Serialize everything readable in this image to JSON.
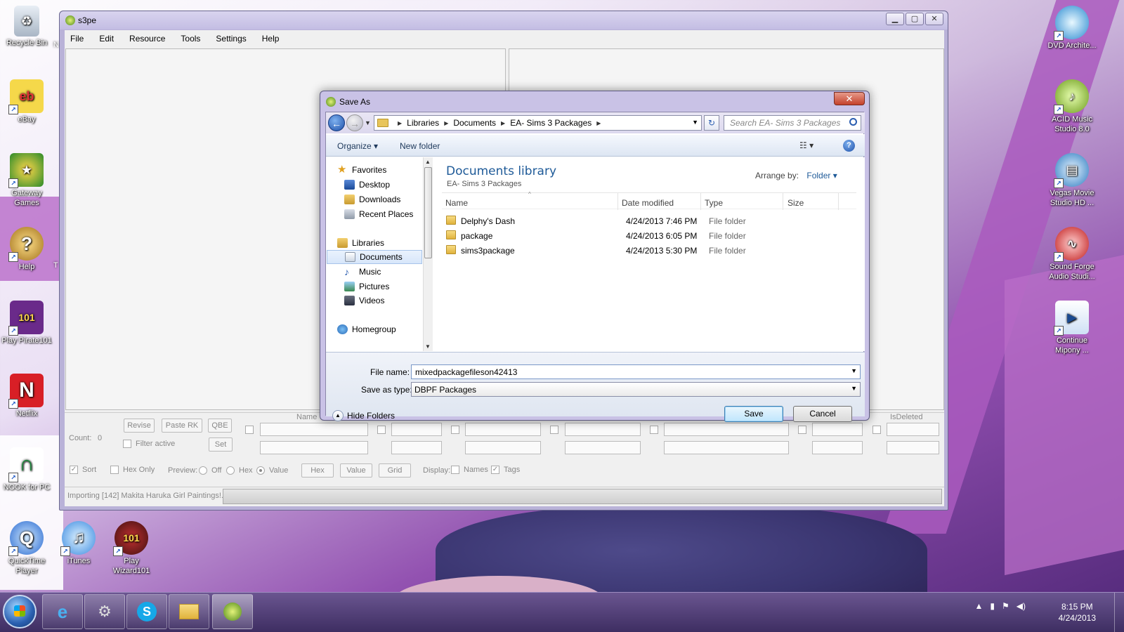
{
  "desktop": {
    "left_icons": [
      {
        "label": "Recycle Bin",
        "icon": "recycle-bin-icon"
      },
      {
        "label": "eBay",
        "icon": "ebay-icon"
      },
      {
        "label": "Gateway Games",
        "icon": "gateway-games-icon"
      },
      {
        "label": "Help",
        "icon": "help-icon"
      },
      {
        "label": "Play Pirate101",
        "icon": "pirate101-icon"
      },
      {
        "label": "Netflix",
        "icon": "netflix-icon"
      },
      {
        "label": "NOOK for PC",
        "icon": "nook-icon"
      }
    ],
    "bottom_icons": [
      {
        "label": "QuickTime Player",
        "icon": "quicktime-icon"
      },
      {
        "label": "iTunes",
        "icon": "itunes-icon"
      },
      {
        "label": "Play Wizard101",
        "icon": "wizard101-icon"
      }
    ],
    "right_icons": [
      {
        "label": "DVD Archite...",
        "icon": "dvd-architect-icon"
      },
      {
        "label": "ACID Music Studio 8.0",
        "icon": "acid-music-icon"
      },
      {
        "label": "Vegas Movie Studio HD ...",
        "icon": "vegas-movie-icon"
      },
      {
        "label": "Sound Forge Audio Studi...",
        "icon": "sound-forge-icon"
      },
      {
        "label": "Continue Mipony ...",
        "icon": "mipony-icon"
      }
    ],
    "partial_labels": {
      "n": "N",
      "t": "T"
    }
  },
  "main_window": {
    "title": "s3pe",
    "menu": [
      "File",
      "Edit",
      "Resource",
      "Tools",
      "Settings",
      "Help"
    ],
    "filter": {
      "count_label": "Count:",
      "count_value": "0",
      "revise": "Revise",
      "paste_rk": "Paste RK",
      "qbe": "QBE",
      "set": "Set",
      "filter_active": "Filter active",
      "name_header": "Name",
      "isdeleted_header": "IsDeleted",
      "sort": "Sort",
      "hex_only": "Hex Only",
      "preview": "Preview:",
      "off": "Off",
      "hex": "Hex",
      "value": "Value",
      "hex_btn": "Hex",
      "value_btn": "Value",
      "grid_btn": "Grid",
      "display": "Display:",
      "names": "Names",
      "tags": "Tags"
    },
    "status_text": "Importing [142] Makita Haruka Girl Paintings!..."
  },
  "dialog": {
    "title": "Save As",
    "close_glyph": "✕",
    "breadcrumb": [
      "Libraries",
      "Documents",
      "EA- Sims 3 Packages"
    ],
    "search_placeholder": "Search EA- Sims 3 Packages",
    "toolbar": {
      "organize": "Organize ▾",
      "new_folder": "New folder",
      "view": "☷ ▾",
      "help": "?"
    },
    "nav": {
      "favorites": "Favorites",
      "desktop": "Desktop",
      "downloads": "Downloads",
      "recent_places": "Recent Places",
      "libraries": "Libraries",
      "documents": "Documents",
      "music": "Music",
      "pictures": "Pictures",
      "videos": "Videos",
      "homegroup": "Homegroup"
    },
    "library_title": "Documents library",
    "library_sub": "EA- Sims 3 Packages",
    "arrange_by_label": "Arrange by:",
    "arrange_by_value": "Folder ▾",
    "columns": [
      "Name",
      "Date modified",
      "Type",
      "Size"
    ],
    "files": [
      {
        "name": "Delphy's Dash",
        "date": "4/24/2013 7:46 PM",
        "type": "File folder"
      },
      {
        "name": "package",
        "date": "4/24/2013 6:05 PM",
        "type": "File folder"
      },
      {
        "name": "sims3package",
        "date": "4/24/2013 5:30 PM",
        "type": "File folder"
      }
    ],
    "file_name_label": "File name:",
    "file_name_value": "mixedpackagefileson42413",
    "save_type_label": "Save as type:",
    "save_type_value": "DBPF Packages",
    "hide_folders": "Hide Folders",
    "save": "Save",
    "cancel": "Cancel"
  },
  "taskbar": {
    "clock_time": "8:15 PM",
    "clock_date": "4/24/2013",
    "apps": [
      "internet-explorer-icon",
      "steam-icon",
      "skype-icon",
      "file-explorer-icon",
      "s3pe-icon"
    ]
  }
}
